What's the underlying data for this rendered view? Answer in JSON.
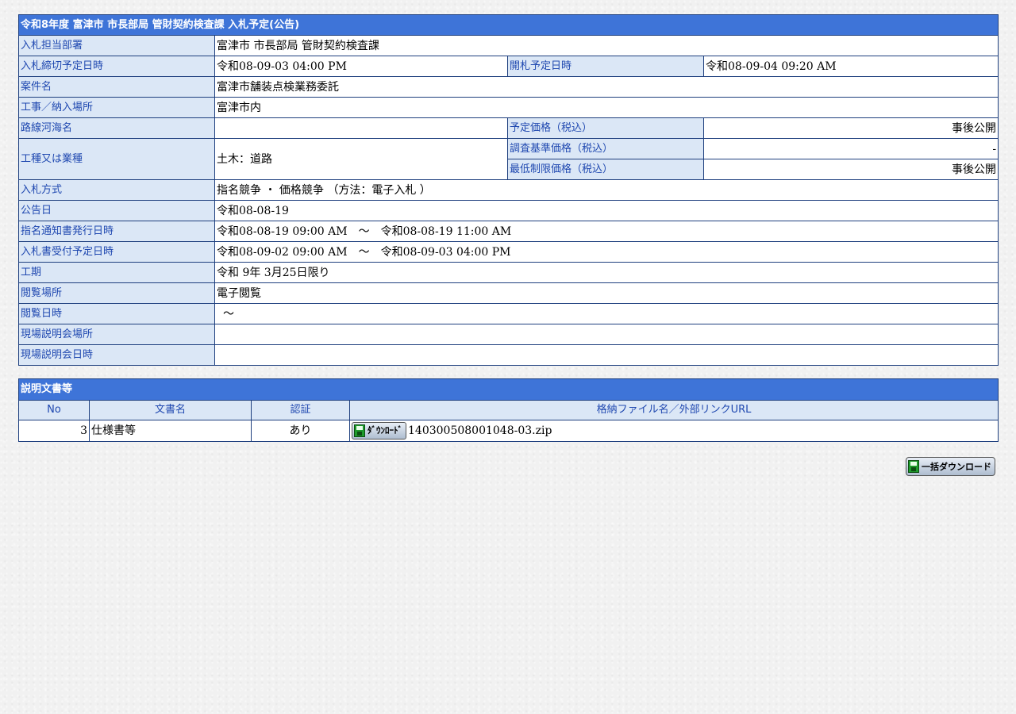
{
  "page_title": "令和8年度 富津市 市長部局 管財契約検査課 入札予定(公告)",
  "rows": {
    "dept": {
      "label": "入札担当部署",
      "value": "富津市 市長部局 管財契約検査課"
    },
    "deadline": {
      "label": "入札締切予定日時",
      "value": "令和08-09-03 04:00 PM"
    },
    "opening": {
      "label": "開札予定日時",
      "value": "令和08-09-04 09:20 AM"
    },
    "project": {
      "label": "案件名",
      "value": "富津市舗装点検業務委託"
    },
    "location": {
      "label": "工事／納入場所",
      "value": "富津市内"
    },
    "route": {
      "label": "路線河海名",
      "value": ""
    },
    "planned_price": {
      "label": "予定価格（税込）",
      "value": "事後公開"
    },
    "category": {
      "label": "工種又は業種",
      "value": "土木：道路"
    },
    "survey_price": {
      "label": "調査基準価格（税込）",
      "value": "-"
    },
    "min_price": {
      "label": "最低制限価格（税込）",
      "value": "事後公開"
    },
    "method": {
      "label": "入札方式",
      "value": "指名競争 ・ 価格競争 （方法：電子入札 ）"
    },
    "notice_date": {
      "label": "公告日",
      "value": "令和08-08-19"
    },
    "nomination": {
      "label": "指名通知書発行日時",
      "value": "令和08-08-19 09:00 AM　～　令和08-08-19 11:00 AM"
    },
    "reception": {
      "label": "入札書受付予定日時",
      "value": "令和08-09-02 09:00 AM　～　令和08-09-03 04:00 PM"
    },
    "period": {
      "label": "工期",
      "value": "令和 9年 3月25日限り"
    },
    "view_place": {
      "label": "閲覧場所",
      "value": "電子閲覧"
    },
    "view_date": {
      "label": "閲覧日時",
      "value": "～"
    },
    "briefing_place": {
      "label": "現場説明会場所",
      "value": ""
    },
    "briefing_date": {
      "label": "現場説明会日時",
      "value": ""
    }
  },
  "docs": {
    "title": "説明文書等",
    "headers": {
      "no": "No",
      "name": "文書名",
      "auth": "認証",
      "file": "格納ファイル名／外部リンクURL"
    },
    "items": [
      {
        "no": "3",
        "name": "仕様書等",
        "auth": "あり",
        "button_label": "ﾀﾞｳﾝﾛｰﾄﾞ",
        "file": "140300508001048-03.zip"
      }
    ]
  },
  "bulk_download_label": "一括ダウンロード",
  "colors": {
    "header_bg": "#3e74d8",
    "label_bg": "#dbe7f6",
    "label_text": "#1f48b0",
    "border": "#1e3f7e"
  }
}
